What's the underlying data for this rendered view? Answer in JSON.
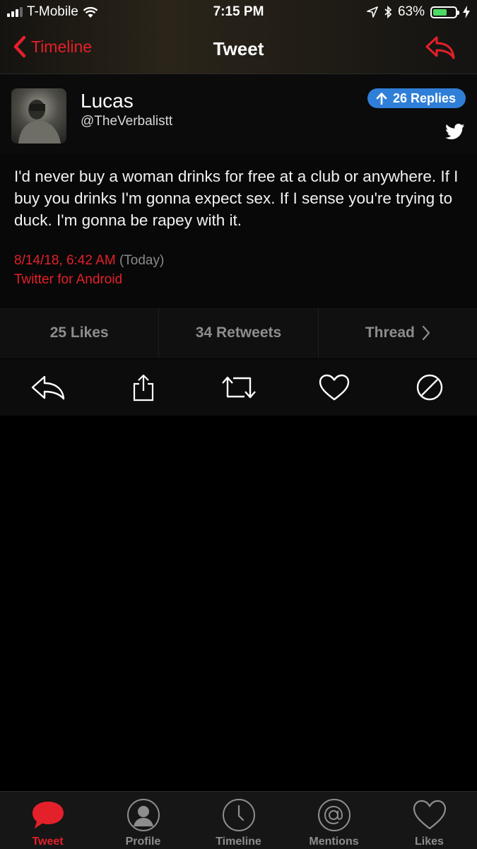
{
  "status_bar": {
    "carrier": "T-Mobile",
    "time": "7:15 PM",
    "battery_percent": "63%",
    "battery_level": 0.63
  },
  "nav": {
    "back_label": "Timeline",
    "title": "Tweet"
  },
  "tweet": {
    "author_name": "Lucas",
    "author_handle": "@TheVerbalistt",
    "replies_label": "26 Replies",
    "text": "I'd never buy a woman drinks for free at a club or anywhere. If I buy you drinks I'm gonna expect sex. If I sense you're trying to duck. I'm gonna be rapey with it.",
    "date": "8/14/18, 6:42 AM",
    "relative_date": "(Today)",
    "source": "Twitter for Android"
  },
  "stats": {
    "likes": "25 Likes",
    "retweets": "34 Retweets",
    "thread": "Thread"
  },
  "tabs": [
    {
      "label": "Tweet",
      "icon": "speech-bubble-icon",
      "active": true
    },
    {
      "label": "Profile",
      "icon": "profile-icon",
      "active": false
    },
    {
      "label": "Timeline",
      "icon": "clock-icon",
      "active": false
    },
    {
      "label": "Mentions",
      "icon": "at-sign-icon",
      "active": false
    },
    {
      "label": "Likes",
      "icon": "heart-icon",
      "active": false
    }
  ],
  "colors": {
    "accent": "#e4202a",
    "badge": "#2f7fd8",
    "battery": "#4cd964",
    "muted": "#8d8d8d"
  }
}
